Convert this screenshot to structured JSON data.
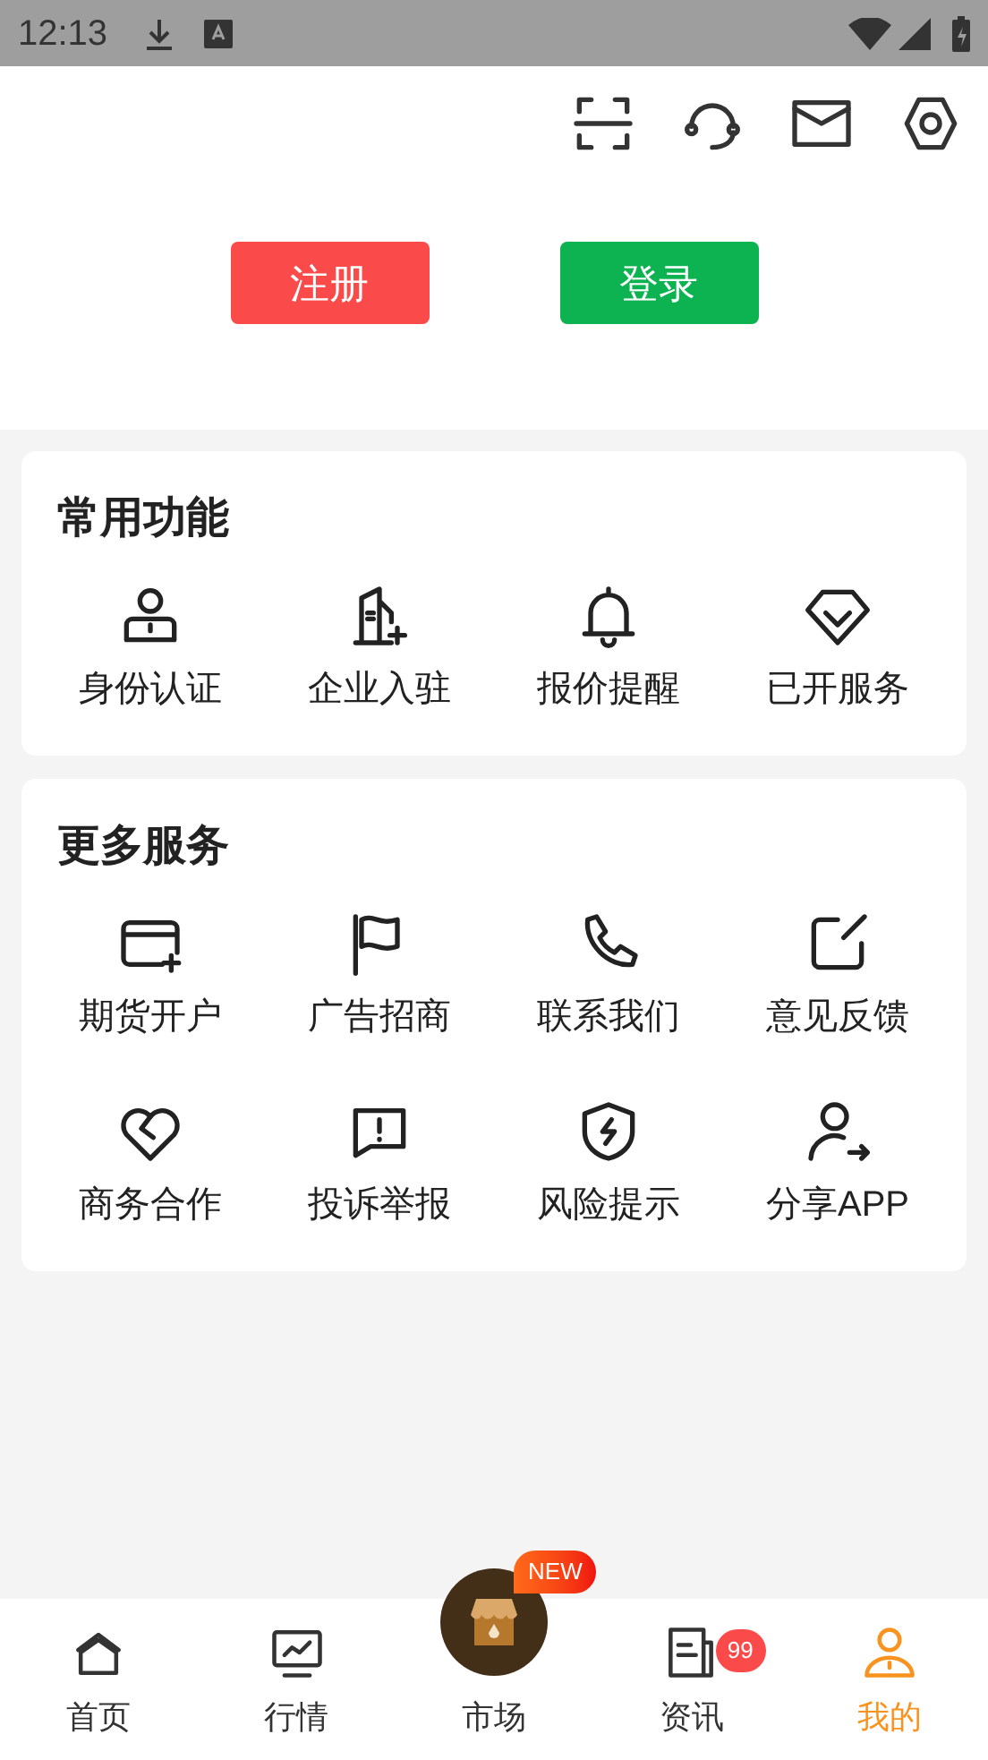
{
  "status_bar": {
    "time": "12:13"
  },
  "auth_buttons": [
    {
      "label": "注册",
      "kind": "register"
    },
    {
      "label": "登录",
      "kind": "login"
    }
  ],
  "sections": [
    {
      "title": "常用功能",
      "items": [
        "身份认证",
        "企业入驻",
        "报价提醒",
        "已开服务"
      ]
    },
    {
      "title": "更多服务",
      "items": [
        "期货开户",
        "广告招商",
        "联系我们",
        "意见反馈",
        "商务合作",
        "投诉举报",
        "风险提示",
        "分享APP"
      ]
    }
  ],
  "tab_bar": [
    {
      "label": "首页",
      "selected": false
    },
    {
      "label": "行情",
      "selected": false
    },
    {
      "label": "市场",
      "selected": false,
      "kind": "featured",
      "badge": {
        "kind": "new",
        "text": "NEW"
      }
    },
    {
      "label": "资讯",
      "selected": false,
      "badge": {
        "kind": "count",
        "text": "99"
      }
    },
    {
      "label": "我的",
      "selected": true
    }
  ]
}
